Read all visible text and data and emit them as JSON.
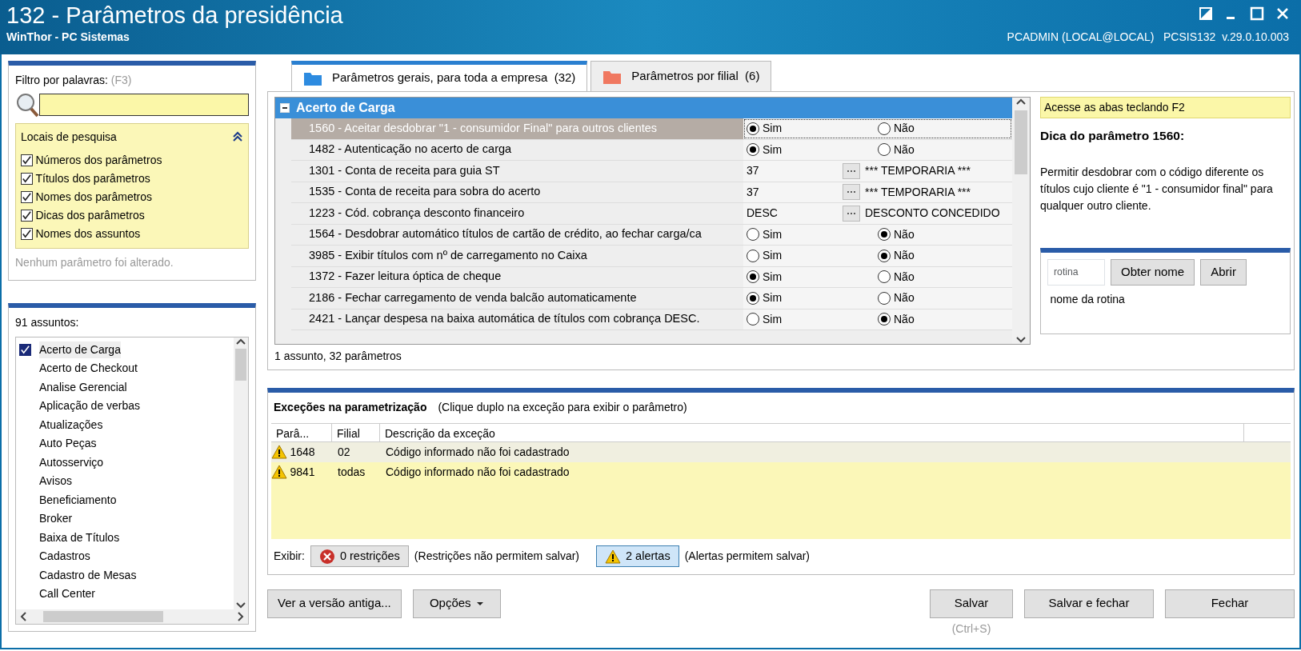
{
  "window": {
    "title": "132 - Parâmetros da presidência",
    "subtitle": "WinThor - PC Sistemas",
    "user_info": "PCADMIN (LOCAL@LOCAL)   PCSIS132  v.29.0.10.003"
  },
  "filter": {
    "label": "Filtro por palavras:",
    "shortcut": "(F3)"
  },
  "search_locations": {
    "title": "Locais de pesquisa",
    "items": [
      {
        "label": "Números dos parâmetros",
        "checked": true
      },
      {
        "label": "Títulos dos parâmetros",
        "checked": true
      },
      {
        "label": "Nomes dos parâmetros",
        "checked": true
      },
      {
        "label": "Dicas dos parâmetros",
        "checked": true
      },
      {
        "label": "Nomes dos assuntos",
        "checked": true
      }
    ]
  },
  "status_note": "Nenhum parâmetro foi alterado.",
  "subjects": {
    "count_label": "91 assuntos:",
    "items": [
      {
        "label": "Acerto de Carga",
        "checked": true,
        "selected": true
      },
      {
        "label": "Acerto de Checkout",
        "checked": false,
        "selected": false
      },
      {
        "label": "Analise Gerencial",
        "checked": false,
        "selected": false
      },
      {
        "label": "Aplicação de verbas",
        "checked": false,
        "selected": false
      },
      {
        "label": "Atualizações",
        "checked": false,
        "selected": false
      },
      {
        "label": "Auto Peças",
        "checked": false,
        "selected": false
      },
      {
        "label": "Autosserviço",
        "checked": false,
        "selected": false
      },
      {
        "label": "Avisos",
        "checked": false,
        "selected": false
      },
      {
        "label": "Beneficiamento",
        "checked": false,
        "selected": false
      },
      {
        "label": "Broker",
        "checked": false,
        "selected": false
      },
      {
        "label": "Baixa de Títulos",
        "checked": false,
        "selected": false
      },
      {
        "label": "Cadastros",
        "checked": false,
        "selected": false
      },
      {
        "label": "Cadastro de Mesas",
        "checked": false,
        "selected": false
      },
      {
        "label": "Call Center",
        "checked": false,
        "selected": false
      }
    ]
  },
  "tabs": [
    {
      "label": "Parâmetros gerais, para toda a empresa  (32)",
      "selected": true,
      "color": "#2d8be0"
    },
    {
      "label": "Parâmetros por filial  (6)",
      "selected": false,
      "color": "#f07860"
    }
  ],
  "grid": {
    "group": "Acerto de Carga",
    "footer": "1 assunto, 32 parâmetros",
    "rows": [
      {
        "kind": "choice",
        "label": "1560 - Aceitar desdobrar \"1 - consumidor Final\" para outros clientes",
        "selected": true,
        "options": [
          {
            "label": "Sim",
            "selected": true
          },
          {
            "label": "Não",
            "selected": false
          }
        ]
      },
      {
        "kind": "choice",
        "label": "1482 - Autenticação no acerto de carga",
        "selected": false,
        "options": [
          {
            "label": "Sim",
            "selected": true
          },
          {
            "label": "Não",
            "selected": false
          }
        ]
      },
      {
        "kind": "lookup",
        "label": "1301 - Conta de receita para guia ST",
        "selected": false,
        "value": "37",
        "description": "*** TEMPORARIA ***"
      },
      {
        "kind": "lookup",
        "label": "1535 - Conta de receita para sobra do acerto",
        "selected": false,
        "value": "37",
        "description": "*** TEMPORARIA ***"
      },
      {
        "kind": "lookup",
        "label": "1223 - Cód. cobrança desconto financeiro",
        "selected": false,
        "value": "DESC",
        "description": "DESCONTO CONCEDIDO"
      },
      {
        "kind": "choice",
        "label": "1564 - Desdobrar automático títulos de cartão de crédito, ao fechar carga/ca",
        "selected": false,
        "options": [
          {
            "label": "Sim",
            "selected": false
          },
          {
            "label": "Não",
            "selected": true
          }
        ]
      },
      {
        "kind": "choice",
        "label": "3985 - Exibir títulos com nº de carregamento no Caixa",
        "selected": false,
        "options": [
          {
            "label": "Sim",
            "selected": false
          },
          {
            "label": "Não",
            "selected": true
          }
        ]
      },
      {
        "kind": "choice",
        "label": "1372 - Fazer leitura óptica de cheque",
        "selected": false,
        "options": [
          {
            "label": "Sim",
            "selected": true
          },
          {
            "label": "Não",
            "selected": false
          }
        ]
      },
      {
        "kind": "choice",
        "label": "2186 - Fechar carregamento de venda balcão automaticamente",
        "selected": false,
        "options": [
          {
            "label": "Sim",
            "selected": true
          },
          {
            "label": "Não",
            "selected": false
          }
        ]
      },
      {
        "kind": "choice",
        "label": "2421 - Lançar despesa na baixa automática de títulos com cobrança DESC.",
        "selected": false,
        "options": [
          {
            "label": "Sim",
            "selected": false
          },
          {
            "label": "Não",
            "selected": true
          }
        ]
      }
    ]
  },
  "hint": {
    "shortcut_note": "Acesse as abas teclando F2",
    "title": "Dica do parâmetro 1560:",
    "text": "Permitir desdobrar com o código diferente os títulos cujo cliente é \"1 - consumidor final\" para qualquer outro cliente."
  },
  "routine": {
    "placeholder": "rotina",
    "buttons": [
      "Obter nome",
      "Abrir"
    ],
    "name_label": "nome da rotina"
  },
  "exceptions": {
    "title": "Exceções na parametrização",
    "note": "(Clique duplo na exceção para exibir o parâmetro)",
    "columns": [
      "Parâ...",
      "Filial",
      "Descrição da exceção"
    ],
    "rows": [
      {
        "parameter": "1648",
        "branch": "02",
        "description": "Código informado não foi cadastrado",
        "selected": true
      },
      {
        "parameter": "9841",
        "branch": "todas",
        "description": "Código informado não foi cadastrado",
        "selected": false
      }
    ]
  },
  "show": {
    "label": "Exibir:",
    "filters": [
      {
        "kind": "error",
        "label": "0 restrições",
        "note": "(Restrições não permitem salvar)",
        "on": false
      },
      {
        "kind": "warning",
        "label": "2 alertas",
        "note": "(Alertas permitem salvar)",
        "on": true
      }
    ]
  },
  "left_buttons": [
    {
      "label": "Ver a versão antiga...",
      "dropdown": false
    },
    {
      "label": "Opções",
      "dropdown": true
    }
  ],
  "right_buttons": [
    "Salvar",
    "Salvar e fechar",
    "Fechar"
  ],
  "save_shortcut": "(Ctrl+S)"
}
